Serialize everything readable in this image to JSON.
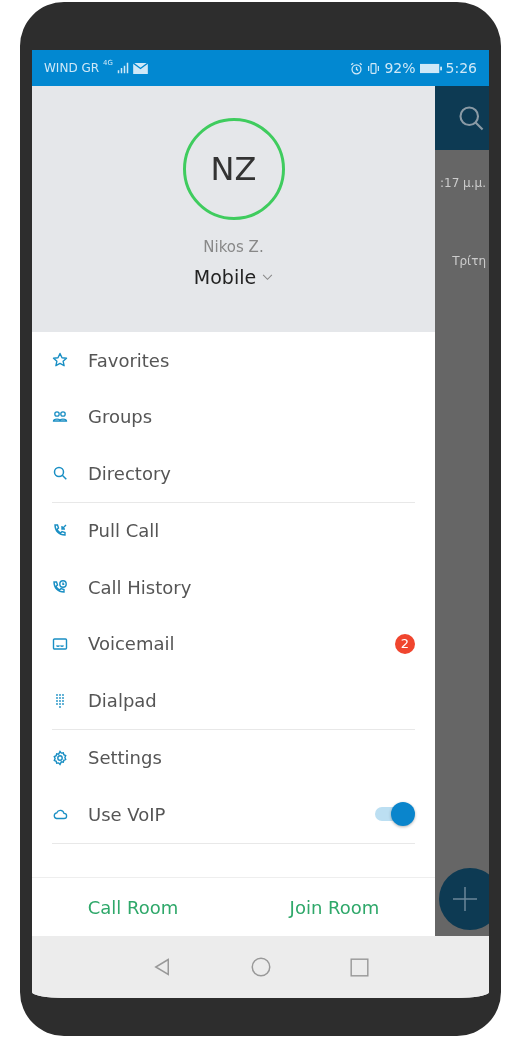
{
  "status_bar": {
    "carrier": "WIND GR",
    "network": "4G",
    "battery": "92%",
    "time": "5:26"
  },
  "profile": {
    "initials": "NZ",
    "name": "Nikos Z.",
    "device": "Mobile"
  },
  "menu_sections": [
    {
      "items": [
        {
          "label": "Favorites",
          "kind": "link"
        },
        {
          "label": "Groups",
          "kind": "link"
        },
        {
          "label": "Directory",
          "kind": "link"
        }
      ]
    },
    {
      "items": [
        {
          "label": "Pull Call",
          "kind": "link"
        },
        {
          "label": "Call History",
          "kind": "link"
        },
        {
          "label": "Voicemail",
          "kind": "link",
          "badge": "2"
        },
        {
          "label": "Dialpad",
          "kind": "link"
        }
      ]
    },
    {
      "items": [
        {
          "label": "Settings",
          "kind": "link"
        },
        {
          "label": "Use VoIP",
          "kind": "toggle",
          "on": true
        }
      ]
    }
  ],
  "footer_buttons": [
    "Call Room",
    "Join Room"
  ],
  "background": {
    "time": ":17 μ.μ.",
    "day": "Τρίτη"
  }
}
